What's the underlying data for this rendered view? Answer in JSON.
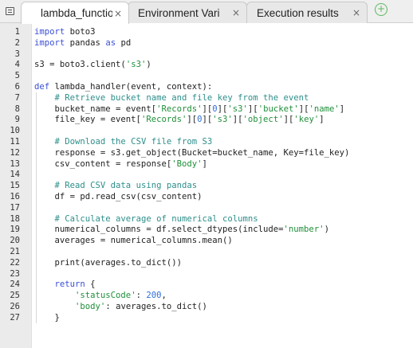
{
  "tabs": [
    {
      "label": "lambda_function",
      "close": "×",
      "active": true
    },
    {
      "label": "Environment Vari",
      "close": "×",
      "active": false
    },
    {
      "label": "Execution results",
      "close": "×",
      "active": false
    }
  ],
  "add_tab": "+",
  "menu_icon": "editor-menu-icon",
  "colors": {
    "keyword": "#3b4fd6",
    "string": "#1f8f3a",
    "comment": "#2d8f8b",
    "number": "#2f6fd8",
    "plain": "#222222",
    "gutter": "#ebebeb",
    "add_tab": "#5cb85c"
  },
  "code_lines": [
    {
      "number": "1",
      "tokens": [
        [
          "k",
          "import"
        ],
        [
          "p",
          " boto3"
        ]
      ]
    },
    {
      "number": "2",
      "tokens": [
        [
          "k",
          "import"
        ],
        [
          "p",
          " pandas "
        ],
        [
          "k",
          "as"
        ],
        [
          "p",
          " pd"
        ]
      ]
    },
    {
      "number": "3",
      "tokens": []
    },
    {
      "number": "4",
      "tokens": [
        [
          "p",
          "s3 = boto3.client("
        ],
        [
          "s",
          "'s3'"
        ],
        [
          "p",
          ")"
        ]
      ]
    },
    {
      "number": "5",
      "tokens": []
    },
    {
      "number": "6",
      "tokens": [
        [
          "k",
          "def"
        ],
        [
          "p",
          " lambda_handler(event, context):"
        ]
      ]
    },
    {
      "number": "7",
      "tokens": [
        [
          "p",
          "    "
        ],
        [
          "c",
          "# Retrieve bucket name and file key from the event"
        ]
      ]
    },
    {
      "number": "8",
      "tokens": [
        [
          "p",
          "    bucket_name = event["
        ],
        [
          "s",
          "'Records'"
        ],
        [
          "p",
          "]["
        ],
        [
          "n",
          "0"
        ],
        [
          "p",
          "]["
        ],
        [
          "s",
          "'s3'"
        ],
        [
          "p",
          "]["
        ],
        [
          "s",
          "'bucket'"
        ],
        [
          "p",
          "]["
        ],
        [
          "s",
          "'name'"
        ],
        [
          "p",
          "]"
        ]
      ]
    },
    {
      "number": "9",
      "tokens": [
        [
          "p",
          "    file_key = event["
        ],
        [
          "s",
          "'Records'"
        ],
        [
          "p",
          "]["
        ],
        [
          "n",
          "0"
        ],
        [
          "p",
          "]["
        ],
        [
          "s",
          "'s3'"
        ],
        [
          "p",
          "]["
        ],
        [
          "s",
          "'object'"
        ],
        [
          "p",
          "]["
        ],
        [
          "s",
          "'key'"
        ],
        [
          "p",
          "]"
        ]
      ]
    },
    {
      "number": "10",
      "tokens": []
    },
    {
      "number": "11",
      "tokens": [
        [
          "p",
          "    "
        ],
        [
          "c",
          "# Download the CSV file from S3"
        ]
      ]
    },
    {
      "number": "12",
      "tokens": [
        [
          "p",
          "    response = s3.get_object(Bucket=bucket_name, Key=file_key)"
        ]
      ]
    },
    {
      "number": "13",
      "tokens": [
        [
          "p",
          "    csv_content = response["
        ],
        [
          "s",
          "'Body'"
        ],
        [
          "p",
          "]"
        ]
      ]
    },
    {
      "number": "14",
      "tokens": []
    },
    {
      "number": "15",
      "tokens": [
        [
          "p",
          "    "
        ],
        [
          "c",
          "# Read CSV data using pandas"
        ]
      ]
    },
    {
      "number": "16",
      "tokens": [
        [
          "p",
          "    df = pd.read_csv(csv_content)"
        ]
      ]
    },
    {
      "number": "17",
      "tokens": []
    },
    {
      "number": "18",
      "tokens": [
        [
          "p",
          "    "
        ],
        [
          "c",
          "# Calculate average of numerical columns"
        ]
      ]
    },
    {
      "number": "19",
      "tokens": [
        [
          "p",
          "    numerical_columns = df.select_dtypes(include="
        ],
        [
          "s",
          "'number'"
        ],
        [
          "p",
          ")"
        ]
      ]
    },
    {
      "number": "20",
      "tokens": [
        [
          "p",
          "    averages = numerical_columns.mean()"
        ]
      ]
    },
    {
      "number": "21",
      "tokens": []
    },
    {
      "number": "22",
      "tokens": [
        [
          "p",
          "    print(averages.to_dict())"
        ]
      ]
    },
    {
      "number": "23",
      "tokens": []
    },
    {
      "number": "24",
      "tokens": [
        [
          "p",
          "    "
        ],
        [
          "k",
          "return"
        ],
        [
          "p",
          " {"
        ]
      ]
    },
    {
      "number": "25",
      "tokens": [
        [
          "p",
          "        "
        ],
        [
          "s",
          "'statusCode'"
        ],
        [
          "p",
          ": "
        ],
        [
          "n",
          "200"
        ],
        [
          "p",
          ","
        ]
      ]
    },
    {
      "number": "26",
      "tokens": [
        [
          "p",
          "        "
        ],
        [
          "s",
          "'body'"
        ],
        [
          "p",
          ": averages.to_dict()"
        ]
      ]
    },
    {
      "number": "27",
      "tokens": [
        [
          "p",
          "    }"
        ]
      ]
    }
  ]
}
